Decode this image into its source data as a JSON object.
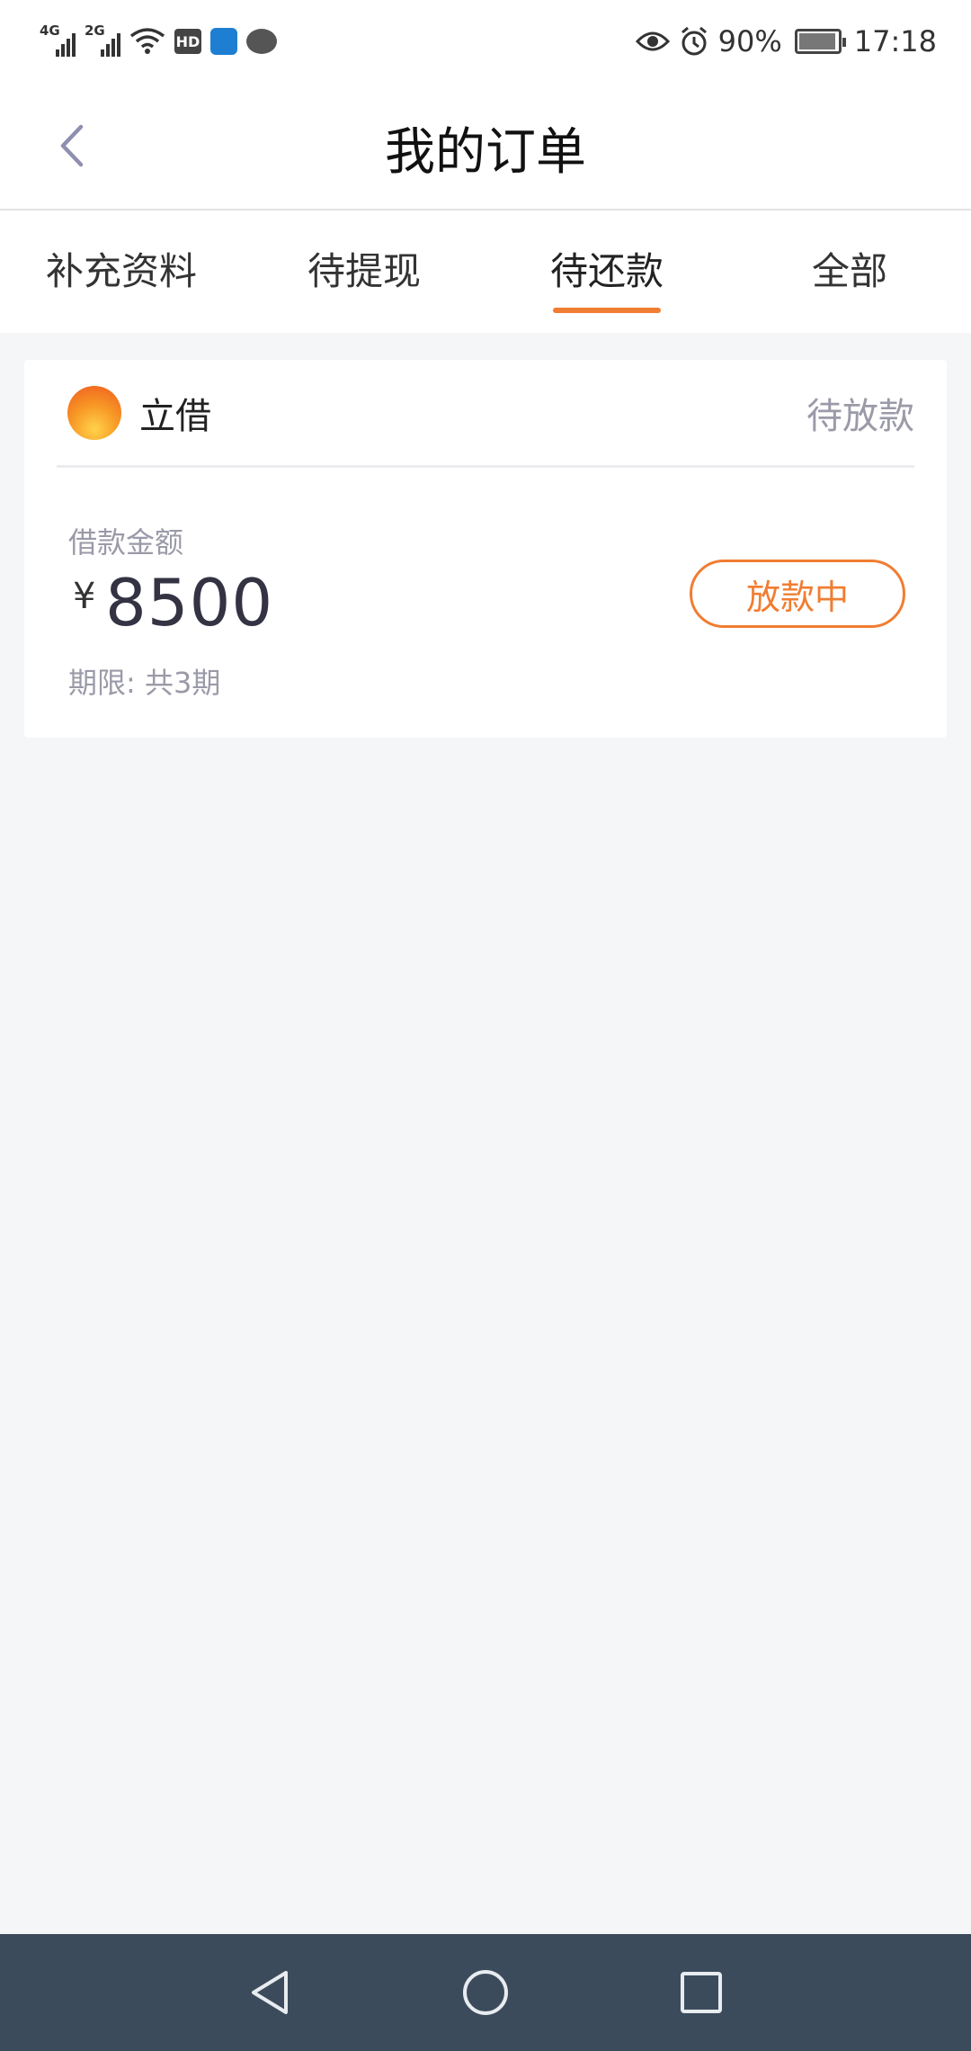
{
  "status_bar": {
    "network1": "4G",
    "network2": "2G",
    "hd_label": "HD",
    "battery_percent": "90%",
    "time": "17:18",
    "icons": [
      "signal-icon",
      "signal-icon",
      "wifi-icon",
      "hd-icon",
      "shield-icon",
      "wechat-icon",
      "eye-icon",
      "alarm-icon",
      "battery-icon"
    ]
  },
  "header": {
    "title": "我的订单"
  },
  "tabs": [
    {
      "label": "补充资料",
      "active": false
    },
    {
      "label": "待提现",
      "active": false
    },
    {
      "label": "待还款",
      "active": true
    },
    {
      "label": "全部",
      "active": false
    }
  ],
  "order": {
    "logo_text": "立借",
    "brand": "立借",
    "status": "待放款",
    "amount_label": "借款金额",
    "currency": "¥",
    "amount": "8500",
    "term": "期限: 共3期",
    "action_label": "放款中"
  },
  "colors": {
    "accent": "#f07d32",
    "muted_text": "#9a9aa8",
    "background": "#f5f6f8",
    "system_nav": "#3c4b5c"
  }
}
